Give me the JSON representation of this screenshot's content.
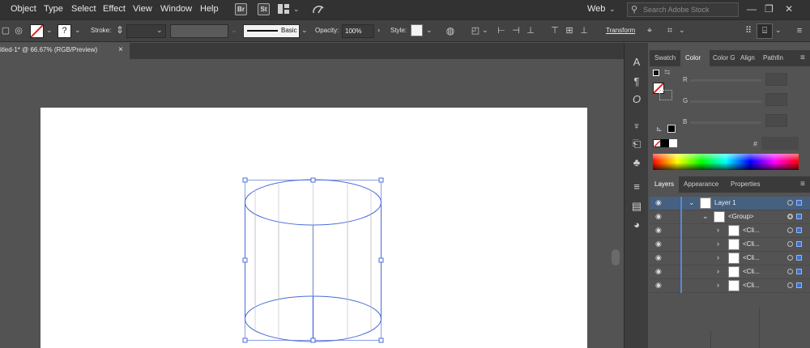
{
  "menubar": {
    "items": [
      "Object",
      "Type",
      "Select",
      "Effect",
      "View",
      "Window",
      "Help"
    ],
    "bridge_label": "Br",
    "stock_label": "St",
    "workspace": "Web",
    "search_placeholder": "Search Adobe Stock"
  },
  "controlbar": {
    "stroke_label": "Stroke:",
    "brush_label": "Basic",
    "opacity_label": "Opacity:",
    "opacity_value": "100%",
    "style_label": "Style:",
    "transform_label": "Transform"
  },
  "document": {
    "tab_title": "itled-1* @ 66.67% (RGB/Preview)",
    "close_glyph": "×"
  },
  "color_panel": {
    "tabs": [
      "Swatch",
      "Color",
      "Color G",
      "Align",
      "Pathfin"
    ],
    "active_tab": "Color",
    "channels": [
      "R",
      "G",
      "B"
    ],
    "hex_symbol": "#"
  },
  "layers_panel": {
    "tabs": [
      "Layers",
      "Appearance",
      "Properties"
    ],
    "rows": [
      {
        "name": "Layer 1",
        "selected": true
      },
      {
        "name": "<Group>"
      },
      {
        "name": "<Cli..."
      },
      {
        "name": "<Cli..."
      },
      {
        "name": "<Cli..."
      },
      {
        "name": "<Cli..."
      },
      {
        "name": "<Cli..."
      }
    ]
  },
  "colors": {
    "selection": "#4a6bd8",
    "layer_color": "#5a86d6",
    "panel_bg": "#535353"
  }
}
